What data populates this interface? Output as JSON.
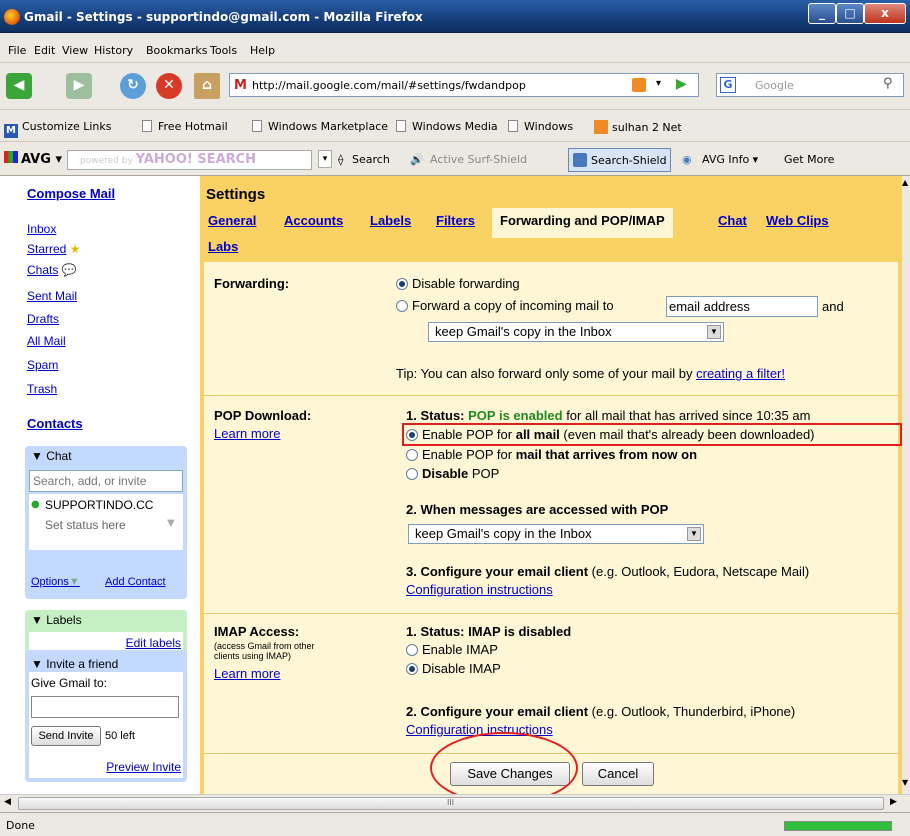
{
  "window": {
    "title": "Gmail - Settings - supportindo@gmail.com - Mozilla Firefox",
    "min": "_",
    "max": "□",
    "close": "x"
  },
  "menu": [
    "File",
    "Edit",
    "View",
    "History",
    "Bookmarks",
    "Tools",
    "Help"
  ],
  "nav": {
    "url": "http://mail.google.com/mail/#settings/fwdandpop",
    "search_placeholder": "Google"
  },
  "bookmarks": [
    "Customize Links",
    "Free Hotmail",
    "Windows Marketplace",
    "Windows Media",
    "Windows",
    "sulhan 2 Net"
  ],
  "avg": {
    "brand": "AVG",
    "yahoo_prefix": "powered by",
    "yahoo": "YAHOO! SEARCH",
    "search": "Search",
    "surf": "Active Surf-Shield",
    "shield": "Search-Shield",
    "info": "AVG Info ▾",
    "more": "Get More"
  },
  "left": {
    "compose": "Compose Mail",
    "items": [
      "Inbox",
      "Starred",
      "Chats",
      "Sent Mail",
      "Drafts",
      "All Mail",
      "Spam",
      "Trash"
    ],
    "contacts": "Contacts",
    "chat": {
      "header": "Chat",
      "placeholder": "Search, add, or invite",
      "user": "SUPPORTINDO.CC",
      "status": "Set status here",
      "options": "Options",
      "add": "Add Contact"
    },
    "labels": {
      "header": "Labels",
      "edit": "Edit labels"
    },
    "invite": {
      "header": "Invite a friend",
      "give": "Give Gmail to:",
      "send": "Send Invite",
      "left": "50 left",
      "preview": "Preview Invite"
    }
  },
  "settings": {
    "title": "Settings",
    "tabs": [
      "General",
      "Accounts",
      "Labels",
      "Filters",
      "Forwarding and POP/IMAP",
      "Chat",
      "Web Clips",
      "Labs"
    ],
    "forwarding": {
      "label": "Forwarding:",
      "disable": "Disable forwarding",
      "forward": "Forward a copy of incoming mail to",
      "email_value": "email address",
      "and": "and",
      "keep": "keep Gmail's copy in the Inbox",
      "tip": "Tip: You can also forward only some of your mail by",
      "tip_link": "creating a filter!"
    },
    "pop": {
      "label": "POP Download:",
      "learn": "Learn more",
      "status_prefix": "1. Status:",
      "status": "POP is enabled",
      "status_suffix": "for all mail that has arrived since 10:35 am",
      "opt1_a": "Enable POP for",
      "opt1_b": "all mail",
      "opt1_c": "(even mail that's already been downloaded)",
      "opt2_a": "Enable POP for",
      "opt2_b": "mail that arrives from now on",
      "opt3": "Disable",
      "opt3_b": "POP",
      "step2": "2. When messages are accessed with POP",
      "keep": "keep Gmail's copy in the Inbox",
      "step3": "3. Configure your email client",
      "step3_eg": "(e.g. Outlook, Eudora, Netscape Mail)",
      "config": "Configuration instructions"
    },
    "imap": {
      "label": "IMAP Access:",
      "sub1": "(access Gmail from other",
      "sub2": "clients using IMAP)",
      "learn": "Learn more",
      "status": "1. Status: IMAP is disabled",
      "enable": "Enable IMAP",
      "disable": "Disable IMAP",
      "step2": "2. Configure your email client",
      "step2_eg": "(e.g. Outlook, Thunderbird, iPhone)",
      "config": "Configuration instructions"
    },
    "save": "Save Changes",
    "cancel": "Cancel"
  },
  "status": {
    "text": "Done"
  },
  "hscroll_mark": "III"
}
